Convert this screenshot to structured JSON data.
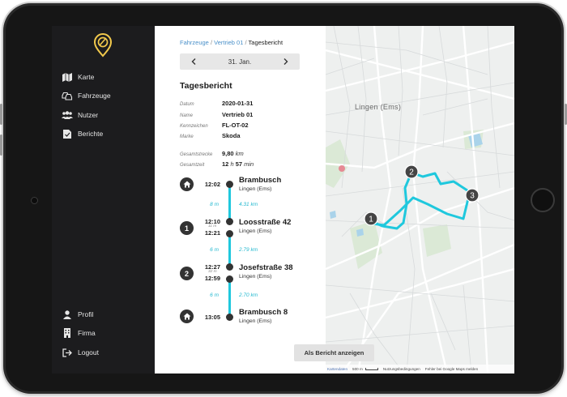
{
  "sidebar": {
    "items": [
      {
        "label": "Karte",
        "icon": "map-icon"
      },
      {
        "label": "Fahrzeuge",
        "icon": "cars-icon"
      },
      {
        "label": "Nutzer",
        "icon": "users-icon"
      },
      {
        "label": "Berichte",
        "icon": "report-icon"
      }
    ],
    "bottom_items": [
      {
        "label": "Profil",
        "icon": "person-icon"
      },
      {
        "label": "Firma",
        "icon": "building-icon"
      },
      {
        "label": "Logout",
        "icon": "logout-icon"
      }
    ]
  },
  "breadcrumb": {
    "items": [
      "Fahrzeuge",
      "Vertrieb 01"
    ],
    "current": "Tagesbericht"
  },
  "date_nav": {
    "label": "31. Jan."
  },
  "report": {
    "title": "Tagesbericht",
    "fields": [
      {
        "key": "Datum",
        "value": "2020-01-31"
      },
      {
        "key": "Name",
        "value": "Vertrieb 01"
      },
      {
        "key": "Kennzeichen",
        "value": "FL-OT-02"
      },
      {
        "key": "Marke",
        "value": "Skoda"
      }
    ],
    "distance": {
      "key": "Gesamtstrecke",
      "value": "9,80",
      "unit": "km"
    },
    "total_time": {
      "key": "Gesamtzeit",
      "hours": "12",
      "h_unit": "h",
      "minutes": "57",
      "m_unit": "min"
    }
  },
  "timeline": {
    "stops": [
      {
        "marker": "home",
        "times": [
          "12:02"
        ],
        "name": "Brambusch",
        "city": "Lingen (Ems)"
      },
      {
        "marker": "1",
        "times": [
          "12:10",
          "12:21"
        ],
        "duration": "11 m",
        "name": "Loosstraße 42",
        "city": "Lingen (Ems)"
      },
      {
        "marker": "2",
        "times": [
          "12:27",
          "12:59"
        ],
        "duration": "32 m",
        "name": "Josefstraße 38",
        "city": "Lingen (Ems)"
      },
      {
        "marker": "home",
        "times": [
          "13:05"
        ],
        "name": "Brambusch 8",
        "city": "Lingen (Ems)"
      }
    ],
    "segments": [
      {
        "minutes": "8 m",
        "distance": "4.31 km"
      },
      {
        "minutes": "6 m",
        "distance": "2.79 km"
      },
      {
        "minutes": "6 m",
        "distance": "2.70 km"
      }
    ]
  },
  "map": {
    "city_label": "Lingen (Ems)",
    "markers": [
      "1",
      "2",
      "3"
    ],
    "report_button": "Als Bericht anzeigen",
    "footer": {
      "data_link": "Kartendaten",
      "scale": "500 m",
      "terms": "Nutzungsbedingungen",
      "report": "Fehler bei Google Maps melden"
    },
    "route_color": "#1fc8dd"
  },
  "colors": {
    "sidebar_bg": "#1c1c1e",
    "accent": "#1fc8dd",
    "logo": "#f2c94c",
    "link": "#4a90c9"
  }
}
